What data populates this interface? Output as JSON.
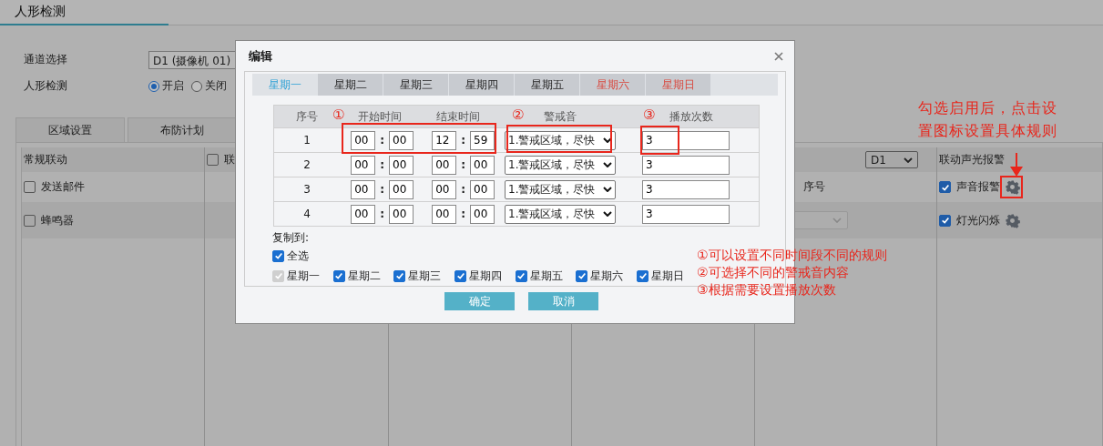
{
  "page_title": "人形检测",
  "channel": {
    "label": "通道选择",
    "value": "D1 (摄像机 01)"
  },
  "detection": {
    "label": "人形检测",
    "options": [
      {
        "label": "开启",
        "selected": true
      },
      {
        "label": "关闭",
        "selected": false
      }
    ]
  },
  "tabs": [
    {
      "label": "区域设置"
    },
    {
      "label": "布防计划"
    }
  ],
  "linkage": {
    "columns": [
      {
        "kind": "list",
        "header": "常规联动",
        "items": [
          {
            "label": "发送邮件",
            "checked": false
          },
          {
            "label": "蜂鸣器",
            "checked": false
          }
        ]
      },
      {
        "kind": "check_header",
        "header": "联",
        "checked": false
      },
      {
        "kind": "empty"
      },
      {
        "kind": "empty"
      },
      {
        "kind": "select",
        "select": "D1",
        "cell": "序号",
        "select_disabled": true
      },
      {
        "kind": "settings_list",
        "header": "联动声光报警",
        "items": [
          {
            "label": "声音报警",
            "checked": true
          },
          {
            "label": "灯光闪烁",
            "checked": true
          }
        ]
      }
    ]
  },
  "dialog": {
    "title": "编辑",
    "days": [
      {
        "label": "星期一",
        "selected": true,
        "weekend": false
      },
      {
        "label": "星期二",
        "selected": false,
        "weekend": false
      },
      {
        "label": "星期三",
        "selected": false,
        "weekend": false
      },
      {
        "label": "星期四",
        "selected": false,
        "weekend": false
      },
      {
        "label": "星期五",
        "selected": false,
        "weekend": false
      },
      {
        "label": "星期六",
        "selected": false,
        "weekend": true
      },
      {
        "label": "星期日",
        "selected": false,
        "weekend": true
      }
    ],
    "columns": [
      "序号",
      "开始时间",
      "结束时间",
      "警戒音",
      "播放次数"
    ],
    "time_separator": ":",
    "rows": [
      {
        "index": "1",
        "start": [
          "00",
          "00"
        ],
        "end": [
          "12",
          "59"
        ],
        "sound": "1.警戒区域，尽快",
        "count": "3"
      },
      {
        "index": "2",
        "start": [
          "00",
          "00"
        ],
        "end": [
          "00",
          "00"
        ],
        "sound": "1.警戒区域，尽快",
        "count": "3"
      },
      {
        "index": "3",
        "start": [
          "00",
          "00"
        ],
        "end": [
          "00",
          "00"
        ],
        "sound": "1.警戒区域，尽快",
        "count": "3"
      },
      {
        "index": "4",
        "start": [
          "00",
          "00"
        ],
        "end": [
          "00",
          "00"
        ],
        "sound": "1.警戒区域，尽快",
        "count": "3"
      }
    ],
    "copy": {
      "label": "复制到:",
      "all": {
        "label": "全选",
        "checked": true
      },
      "days": [
        {
          "label": "星期一",
          "checked": true,
          "disabled": true
        },
        {
          "label": "星期二",
          "checked": true,
          "disabled": false
        },
        {
          "label": "星期三",
          "checked": true,
          "disabled": false
        },
        {
          "label": "星期四",
          "checked": true,
          "disabled": false
        },
        {
          "label": "星期五",
          "checked": true,
          "disabled": false
        },
        {
          "label": "星期六",
          "checked": true,
          "disabled": false
        },
        {
          "label": "星期日",
          "checked": true,
          "disabled": false
        }
      ]
    },
    "buttons": [
      "确定",
      "取消"
    ]
  },
  "annotations": {
    "markers": [
      "①",
      "②",
      "③"
    ],
    "notes": [
      "①可以设置不同时间段不同的规则",
      "②可选择不同的警戒音内容",
      "③根据需要设置播放次数"
    ],
    "callout": [
      "勾选启用后，点击设",
      "置图标设置具体规则"
    ]
  }
}
